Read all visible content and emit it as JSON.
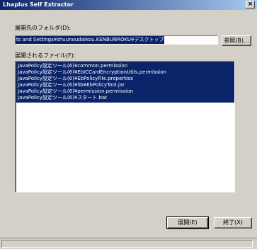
{
  "window": {
    "title": "Lhaplus Self Extractor",
    "close_glyph": "×"
  },
  "destination": {
    "label": "展開先のフォルダ(D):",
    "value": "ts and Settings¥shuunoudaikou.KENBUNROKU¥デスクトップ",
    "browse_label": "参照(B)..."
  },
  "files": {
    "label": "展開されるファイル(F):",
    "items": [
      "JavaPolicy設定ツール(6)¥common.permission",
      "JavaPolicy設定ツール(6)¥EbICCardEncryptionUtils.permission",
      "JavaPolicy設定ツール(6)¥EbPolicyFile.properties",
      "JavaPolicy設定ツール(6)¥lib¥EbPolicyTool.jar",
      "JavaPolicy設定ツール(6)¥permission.permission",
      "JavaPolicy設定ツール(6)¥スタート.bat"
    ]
  },
  "buttons": {
    "extract_label": "展開(E)",
    "exit_label": "終了(X)"
  },
  "colors": {
    "selection": "#0a246a",
    "face": "#d4d0c8"
  }
}
